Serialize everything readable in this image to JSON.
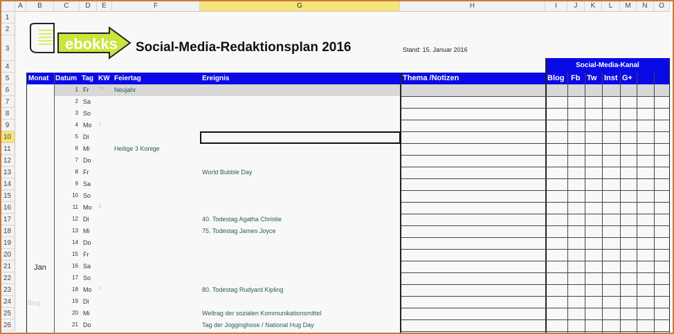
{
  "columns": [
    "A",
    "B",
    "C",
    "D",
    "E",
    "F",
    "G",
    "H",
    "I",
    "J",
    "K",
    "L",
    "M",
    "N",
    "O"
  ],
  "row_numbers": [
    "1",
    "2",
    "3",
    "4",
    "5",
    "6",
    "7",
    "8",
    "9",
    "10",
    "11",
    "12",
    "13",
    "14",
    "15",
    "16",
    "17",
    "18",
    "19",
    "20",
    "21",
    "22",
    "23",
    "24",
    "25",
    "26"
  ],
  "selected_column": "G",
  "selected_row": "10",
  "logo": {
    "text": "ebokks",
    "color": "#c8e63c"
  },
  "title": "Social-Media-Redaktionsplan 2016",
  "stand": "Stand: 15. Januar 2016",
  "kanal_header": "Social-Media-Kanal",
  "headers": {
    "monat": "Monat",
    "datum": "Datum",
    "tag": "Tag",
    "kw": "KW",
    "feiertag": "Feiertag",
    "ereignis": "Ereignis",
    "thema": "Thema /Notizen",
    "blog": "Blog",
    "fb": "Fb",
    "tw": "Tw",
    "inst": "Inst",
    "gplus": "G+"
  },
  "month": "Jan",
  "faded_label": "Blog",
  "accent": "#0a0ae6",
  "rows": [
    {
      "datum": "1",
      "tag": "Fr",
      "kw": "53",
      "feiertag": "Neujahr",
      "ereignis": ""
    },
    {
      "datum": "2",
      "tag": "Sa",
      "kw": "",
      "feiertag": "",
      "ereignis": ""
    },
    {
      "datum": "3",
      "tag": "So",
      "kw": "",
      "feiertag": "",
      "ereignis": ""
    },
    {
      "datum": "4",
      "tag": "Mo",
      "kw": "1",
      "feiertag": "",
      "ereignis": ""
    },
    {
      "datum": "5",
      "tag": "Di",
      "kw": "",
      "feiertag": "",
      "ereignis": ""
    },
    {
      "datum": "6",
      "tag": "Mi",
      "kw": "",
      "feiertag": "Heilige 3 Konige",
      "ereignis": ""
    },
    {
      "datum": "7",
      "tag": "Do",
      "kw": "",
      "feiertag": "",
      "ereignis": ""
    },
    {
      "datum": "8",
      "tag": "Fr",
      "kw": "",
      "feiertag": "",
      "ereignis": "World Bubble Day"
    },
    {
      "datum": "9",
      "tag": "Sa",
      "kw": "",
      "feiertag": "",
      "ereignis": ""
    },
    {
      "datum": "10",
      "tag": "So",
      "kw": "",
      "feiertag": "",
      "ereignis": ""
    },
    {
      "datum": "11",
      "tag": "Mo",
      "kw": "2",
      "feiertag": "",
      "ereignis": ""
    },
    {
      "datum": "12",
      "tag": "Di",
      "kw": "",
      "feiertag": "",
      "ereignis": "40. Todestag Agatha Christie"
    },
    {
      "datum": "13",
      "tag": "Mi",
      "kw": "",
      "feiertag": "",
      "ereignis": "75. Todestag James Joyce"
    },
    {
      "datum": "14",
      "tag": "Do",
      "kw": "",
      "feiertag": "",
      "ereignis": ""
    },
    {
      "datum": "15",
      "tag": "Fr",
      "kw": "",
      "feiertag": "",
      "ereignis": ""
    },
    {
      "datum": "16",
      "tag": "Sa",
      "kw": "",
      "feiertag": "",
      "ereignis": ""
    },
    {
      "datum": "17",
      "tag": "So",
      "kw": "",
      "feiertag": "",
      "ereignis": ""
    },
    {
      "datum": "18",
      "tag": "Mo",
      "kw": "3",
      "feiertag": "",
      "ereignis": "80. Todestag Rudyard Kipling"
    },
    {
      "datum": "19",
      "tag": "Di",
      "kw": "",
      "feiertag": "",
      "ereignis": ""
    },
    {
      "datum": "20",
      "tag": "Mi",
      "kw": "",
      "feiertag": "",
      "ereignis": "Weltrag der sozialen Kommunikationsmittel"
    },
    {
      "datum": "21",
      "tag": "Do",
      "kw": "",
      "feiertag": "",
      "ereignis": "Tag der Jogginghose / National Hug Day"
    }
  ]
}
